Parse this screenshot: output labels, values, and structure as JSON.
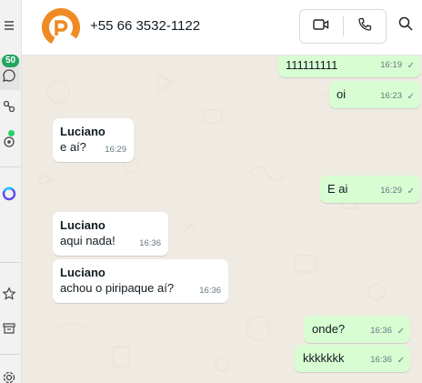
{
  "rail": {
    "unread_badge": "50"
  },
  "header": {
    "contact_name": "+55 66 3532-1122"
  },
  "messages": [
    {
      "dir": "out",
      "text": "111111111",
      "time": "16:19",
      "status": "✓"
    },
    {
      "dir": "out",
      "text": "oi",
      "time": "16:23",
      "status": "✓"
    },
    {
      "dir": "in",
      "sender": "Luciano",
      "text": "e aí?",
      "time": "16:29"
    },
    {
      "dir": "out",
      "text": "E ai",
      "time": "16:29",
      "status": "✓"
    },
    {
      "dir": "in",
      "sender": "Luciano",
      "text": "aqui nada!",
      "time": "16:36"
    },
    {
      "dir": "in",
      "sender": "Luciano",
      "text": "achou o piripaque aí?",
      "time": "16:36"
    },
    {
      "dir": "out",
      "text": "onde?",
      "time": "16:36",
      "status": "✓"
    },
    {
      "dir": "out",
      "text": "kkkkkkk",
      "time": "16:36",
      "status": "✓"
    }
  ],
  "colors": {
    "incoming_bubble": "#ffffff",
    "outgoing_bubble": "#d9fdd3",
    "chat_background": "#efeae2",
    "badge": "#25a55f",
    "avatar_accent": "#f08a24"
  }
}
